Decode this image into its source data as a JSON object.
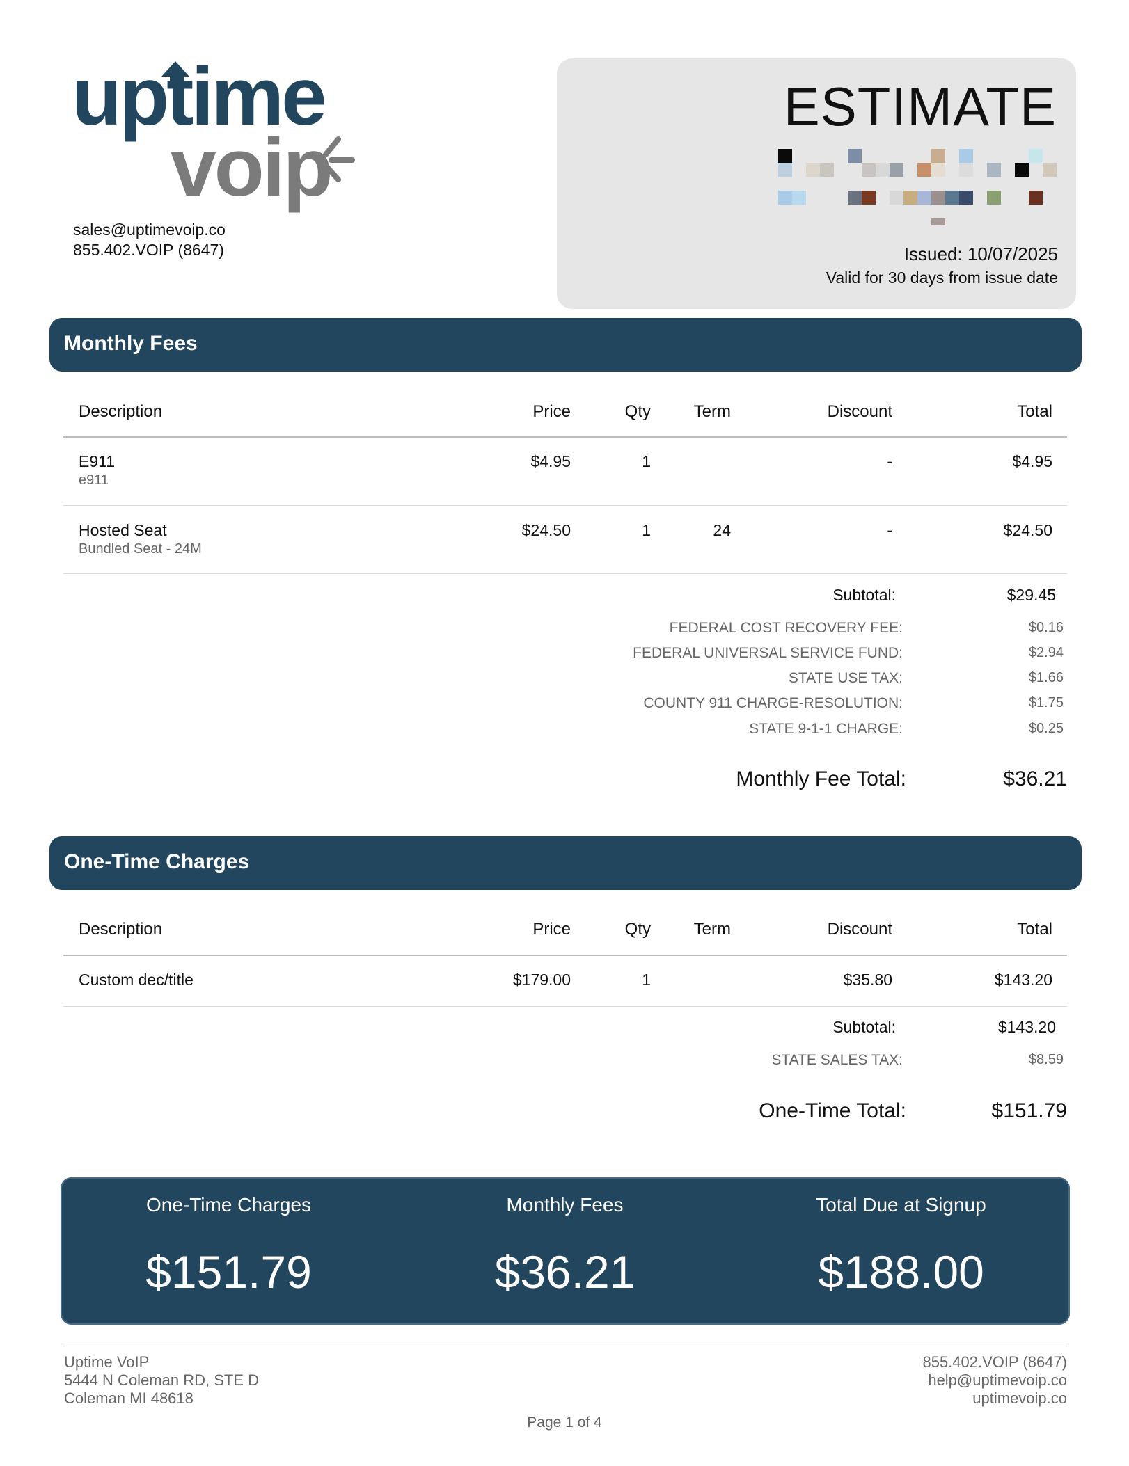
{
  "logo": {
    "word1": "uptime",
    "word2": "voip"
  },
  "contact": {
    "email": "sales@uptimevoip.co",
    "phone": "855.402.VOIP (8647)"
  },
  "estimate": {
    "title": "ESTIMATE",
    "issued": "Issued: 10/07/2025",
    "valid": "Valid for 30 days from issue date"
  },
  "monthly": {
    "title": "Monthly Fees",
    "headers": {
      "description": "Description",
      "price": "Price",
      "qty": "Qty",
      "term": "Term",
      "discount": "Discount",
      "total": "Total"
    },
    "rows": [
      {
        "name": "E911",
        "sub": "e911",
        "price": "$4.95",
        "qty": "1",
        "term": "",
        "discount": "-",
        "total": "$4.95"
      },
      {
        "name": "Hosted Seat",
        "sub": "Bundled Seat - 24M",
        "price": "$24.50",
        "qty": "1",
        "term": "24",
        "discount": "-",
        "total": "$24.50"
      }
    ],
    "subtotal_label": "Subtotal:",
    "subtotal": "$29.45",
    "taxes": [
      {
        "label": "FEDERAL COST RECOVERY FEE:",
        "value": "$0.16"
      },
      {
        "label": "FEDERAL UNIVERSAL SERVICE FUND:",
        "value": "$2.94"
      },
      {
        "label": "STATE USE TAX:",
        "value": "$1.66"
      },
      {
        "label": "COUNTY 911 CHARGE-RESOLUTION:",
        "value": "$1.75"
      },
      {
        "label": "STATE 9-1-1 CHARGE:",
        "value": "$0.25"
      }
    ],
    "total_label": "Monthly Fee Total:",
    "total": "$36.21"
  },
  "onetime": {
    "title": "One-Time Charges",
    "headers": {
      "description": "Description",
      "price": "Price",
      "qty": "Qty",
      "term": "Term",
      "discount": "Discount",
      "total": "Total"
    },
    "rows": [
      {
        "name": "Custom dec/title",
        "price": "$179.00",
        "qty": "1",
        "term": "",
        "discount": "$35.80",
        "total": "$143.20"
      }
    ],
    "subtotal_label": "Subtotal:",
    "subtotal": "$143.20",
    "taxes": [
      {
        "label": "STATE SALES TAX:",
        "value": "$8.59"
      }
    ],
    "total_label": "One-Time Total:",
    "total": "$151.79"
  },
  "summary": [
    {
      "label": "One-Time Charges",
      "value": "$151.79"
    },
    {
      "label": "Monthly Fees",
      "value": "$36.21"
    },
    {
      "label": "Total Due at Signup",
      "value": "$188.00"
    }
  ],
  "footer": {
    "company": "Uptime VoIP",
    "address1": "5444 N Coleman RD, STE D",
    "address2": "Coleman MI 48618",
    "phone": "855.402.VOIP (8647)",
    "email": "help@uptimevoip.co",
    "website": "uptimevoip.co",
    "page": "Page 1 of 4"
  },
  "colors": {
    "brand_navy": "#23465f",
    "brand_gray": "#7b7b7b",
    "estimate_box": "#e6e6e6"
  }
}
